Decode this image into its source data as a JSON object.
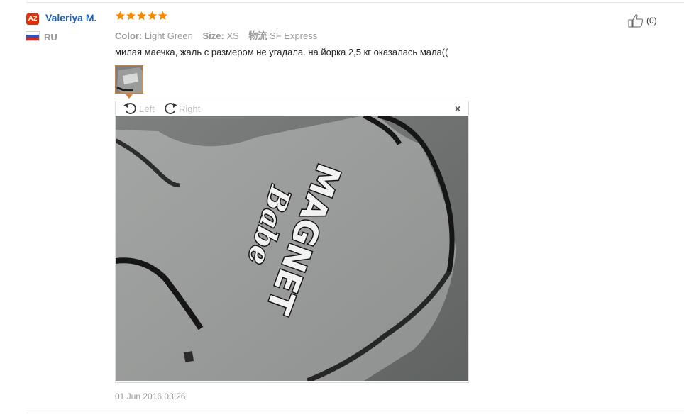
{
  "reviewer": {
    "level_badge": "A2",
    "name": "Valeriya M.",
    "country": "RU",
    "flag_colors": [
      "#ffffff",
      "#2c55c4",
      "#d52b1e"
    ]
  },
  "review": {
    "rating": 5,
    "star_color": "#f28b00",
    "attributes": [
      {
        "key": "Color:",
        "value": "Light Green"
      },
      {
        "key": "Size:",
        "value": "XS"
      },
      {
        "key": "物流",
        "value": "SF Express"
      }
    ],
    "text": "милая маечка, жаль с размером не угадала. на йорка 2,5 кг оказалась мала((",
    "date": "01 Jun 2016 03:26",
    "photo_icon": "shirt-photo"
  },
  "viewer": {
    "rotate_left_label": "Left",
    "rotate_right_label": "Right",
    "close_label": "×",
    "photo_text_line1": "MAGNET",
    "photo_text_line2": "Babe"
  },
  "helpful": {
    "count_label": "(0)",
    "icon": "thumbs-up-icon"
  }
}
